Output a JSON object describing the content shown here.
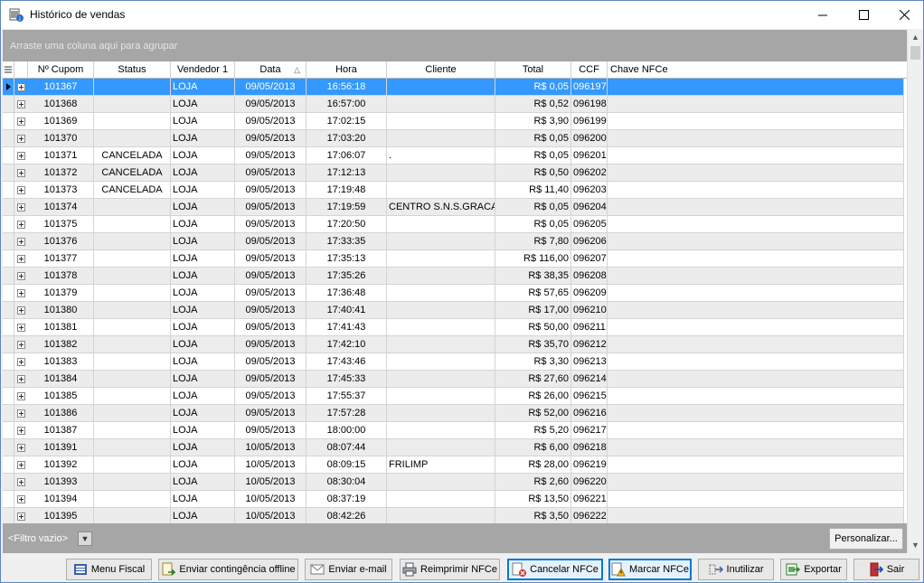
{
  "window": {
    "title": "Histórico de vendas"
  },
  "group_panel": {
    "text": "Arraste uma coluna aqui para agrupar"
  },
  "columns": [
    "Nº Cupom",
    "Status",
    "Vendedor 1",
    "Data",
    "Hora",
    "Cliente",
    "Total",
    "CCF",
    "Chave NFCe"
  ],
  "sort": {
    "column": "Data",
    "direction": "ascending"
  },
  "rows": [
    {
      "cupom": "101367",
      "status": "",
      "vendedor": "LOJA",
      "data": "09/05/2013",
      "hora": "16:56:18",
      "cliente": "",
      "total": "R$ 0,05",
      "ccf": "096197",
      "chave": ""
    },
    {
      "cupom": "101368",
      "status": "",
      "vendedor": "LOJA",
      "data": "09/05/2013",
      "hora": "16:57:00",
      "cliente": "",
      "total": "R$ 0,52",
      "ccf": "096198",
      "chave": ""
    },
    {
      "cupom": "101369",
      "status": "",
      "vendedor": "LOJA",
      "data": "09/05/2013",
      "hora": "17:02:15",
      "cliente": "",
      "total": "R$ 3,90",
      "ccf": "096199",
      "chave": ""
    },
    {
      "cupom": "101370",
      "status": "",
      "vendedor": "LOJA",
      "data": "09/05/2013",
      "hora": "17:03:20",
      "cliente": "",
      "total": "R$ 0,05",
      "ccf": "096200",
      "chave": ""
    },
    {
      "cupom": "101371",
      "status": "CANCELADA",
      "vendedor": "LOJA",
      "data": "09/05/2013",
      "hora": "17:06:07",
      "cliente": ".",
      "total": "R$ 0,05",
      "ccf": "096201",
      "chave": ""
    },
    {
      "cupom": "101372",
      "status": "CANCELADA",
      "vendedor": "LOJA",
      "data": "09/05/2013",
      "hora": "17:12:13",
      "cliente": "",
      "total": "R$ 0,50",
      "ccf": "096202",
      "chave": ""
    },
    {
      "cupom": "101373",
      "status": "CANCELADA",
      "vendedor": "LOJA",
      "data": "09/05/2013",
      "hora": "17:19:48",
      "cliente": "",
      "total": "R$ 11,40",
      "ccf": "096203",
      "chave": ""
    },
    {
      "cupom": "101374",
      "status": "",
      "vendedor": "LOJA",
      "data": "09/05/2013",
      "hora": "17:19:59",
      "cliente": "CENTRO S.N.S.GRACAS",
      "total": "R$ 0,05",
      "ccf": "096204",
      "chave": ""
    },
    {
      "cupom": "101375",
      "status": "",
      "vendedor": "LOJA",
      "data": "09/05/2013",
      "hora": "17:20:50",
      "cliente": "",
      "total": "R$ 0,05",
      "ccf": "096205",
      "chave": ""
    },
    {
      "cupom": "101376",
      "status": "",
      "vendedor": "LOJA",
      "data": "09/05/2013",
      "hora": "17:33:35",
      "cliente": "",
      "total": "R$ 7,80",
      "ccf": "096206",
      "chave": ""
    },
    {
      "cupom": "101377",
      "status": "",
      "vendedor": "LOJA",
      "data": "09/05/2013",
      "hora": "17:35:13",
      "cliente": "",
      "total": "R$ 116,00",
      "ccf": "096207",
      "chave": ""
    },
    {
      "cupom": "101378",
      "status": "",
      "vendedor": "LOJA",
      "data": "09/05/2013",
      "hora": "17:35:26",
      "cliente": "",
      "total": "R$ 38,35",
      "ccf": "096208",
      "chave": ""
    },
    {
      "cupom": "101379",
      "status": "",
      "vendedor": "LOJA",
      "data": "09/05/2013",
      "hora": "17:36:48",
      "cliente": "",
      "total": "R$ 57,65",
      "ccf": "096209",
      "chave": ""
    },
    {
      "cupom": "101380",
      "status": "",
      "vendedor": "LOJA",
      "data": "09/05/2013",
      "hora": "17:40:41",
      "cliente": "",
      "total": "R$ 17,00",
      "ccf": "096210",
      "chave": ""
    },
    {
      "cupom": "101381",
      "status": "",
      "vendedor": "LOJA",
      "data": "09/05/2013",
      "hora": "17:41:43",
      "cliente": "",
      "total": "R$ 50,00",
      "ccf": "096211",
      "chave": ""
    },
    {
      "cupom": "101382",
      "status": "",
      "vendedor": "LOJA",
      "data": "09/05/2013",
      "hora": "17:42:10",
      "cliente": "",
      "total": "R$ 35,70",
      "ccf": "096212",
      "chave": ""
    },
    {
      "cupom": "101383",
      "status": "",
      "vendedor": "LOJA",
      "data": "09/05/2013",
      "hora": "17:43:46",
      "cliente": "",
      "total": "R$ 3,30",
      "ccf": "096213",
      "chave": ""
    },
    {
      "cupom": "101384",
      "status": "",
      "vendedor": "LOJA",
      "data": "09/05/2013",
      "hora": "17:45:33",
      "cliente": "",
      "total": "R$ 27,60",
      "ccf": "096214",
      "chave": ""
    },
    {
      "cupom": "101385",
      "status": "",
      "vendedor": "LOJA",
      "data": "09/05/2013",
      "hora": "17:55:37",
      "cliente": "",
      "total": "R$ 26,00",
      "ccf": "096215",
      "chave": ""
    },
    {
      "cupom": "101386",
      "status": "",
      "vendedor": "LOJA",
      "data": "09/05/2013",
      "hora": "17:57:28",
      "cliente": "",
      "total": "R$ 52,00",
      "ccf": "096216",
      "chave": ""
    },
    {
      "cupom": "101387",
      "status": "",
      "vendedor": "LOJA",
      "data": "09/05/2013",
      "hora": "18:00:00",
      "cliente": "",
      "total": "R$ 5,20",
      "ccf": "096217",
      "chave": ""
    },
    {
      "cupom": "101391",
      "status": "",
      "vendedor": "LOJA",
      "data": "10/05/2013",
      "hora": "08:07:44",
      "cliente": "",
      "total": "R$ 6,00",
      "ccf": "096218",
      "chave": ""
    },
    {
      "cupom": "101392",
      "status": "",
      "vendedor": "LOJA",
      "data": "10/05/2013",
      "hora": "08:09:15",
      "cliente": "FRILIMP",
      "total": "R$ 28,00",
      "ccf": "096219",
      "chave": ""
    },
    {
      "cupom": "101393",
      "status": "",
      "vendedor": "LOJA",
      "data": "10/05/2013",
      "hora": "08:30:04",
      "cliente": "",
      "total": "R$ 2,60",
      "ccf": "096220",
      "chave": ""
    },
    {
      "cupom": "101394",
      "status": "",
      "vendedor": "LOJA",
      "data": "10/05/2013",
      "hora": "08:37:19",
      "cliente": "",
      "total": "R$ 13,50",
      "ccf": "096221",
      "chave": ""
    },
    {
      "cupom": "101395",
      "status": "",
      "vendedor": "LOJA",
      "data": "10/05/2013",
      "hora": "08:42:26",
      "cliente": "",
      "total": "R$ 3,50",
      "ccf": "096222",
      "chave": ""
    }
  ],
  "selected_row": 0,
  "filter": {
    "text": "<Filtro vazio>",
    "customize_label": "Personalizar..."
  },
  "toolbar": {
    "menu_fiscal": "Menu Fiscal",
    "enviar_contingencia": "Enviar contingência offline",
    "enviar_email": "Enviar e-mail",
    "reimprimir": "Reimprimir NFCe",
    "cancelar": "Cancelar NFCe",
    "marcar": "Marcar NFCe",
    "inutilizar": "Inutilizar",
    "exportar": "Exportar",
    "sair": "Sair"
  },
  "colors": {
    "selection": "#3399ff",
    "alt_row": "#ececec",
    "panel": "#a6a6a6",
    "accent": "#0078d7"
  }
}
